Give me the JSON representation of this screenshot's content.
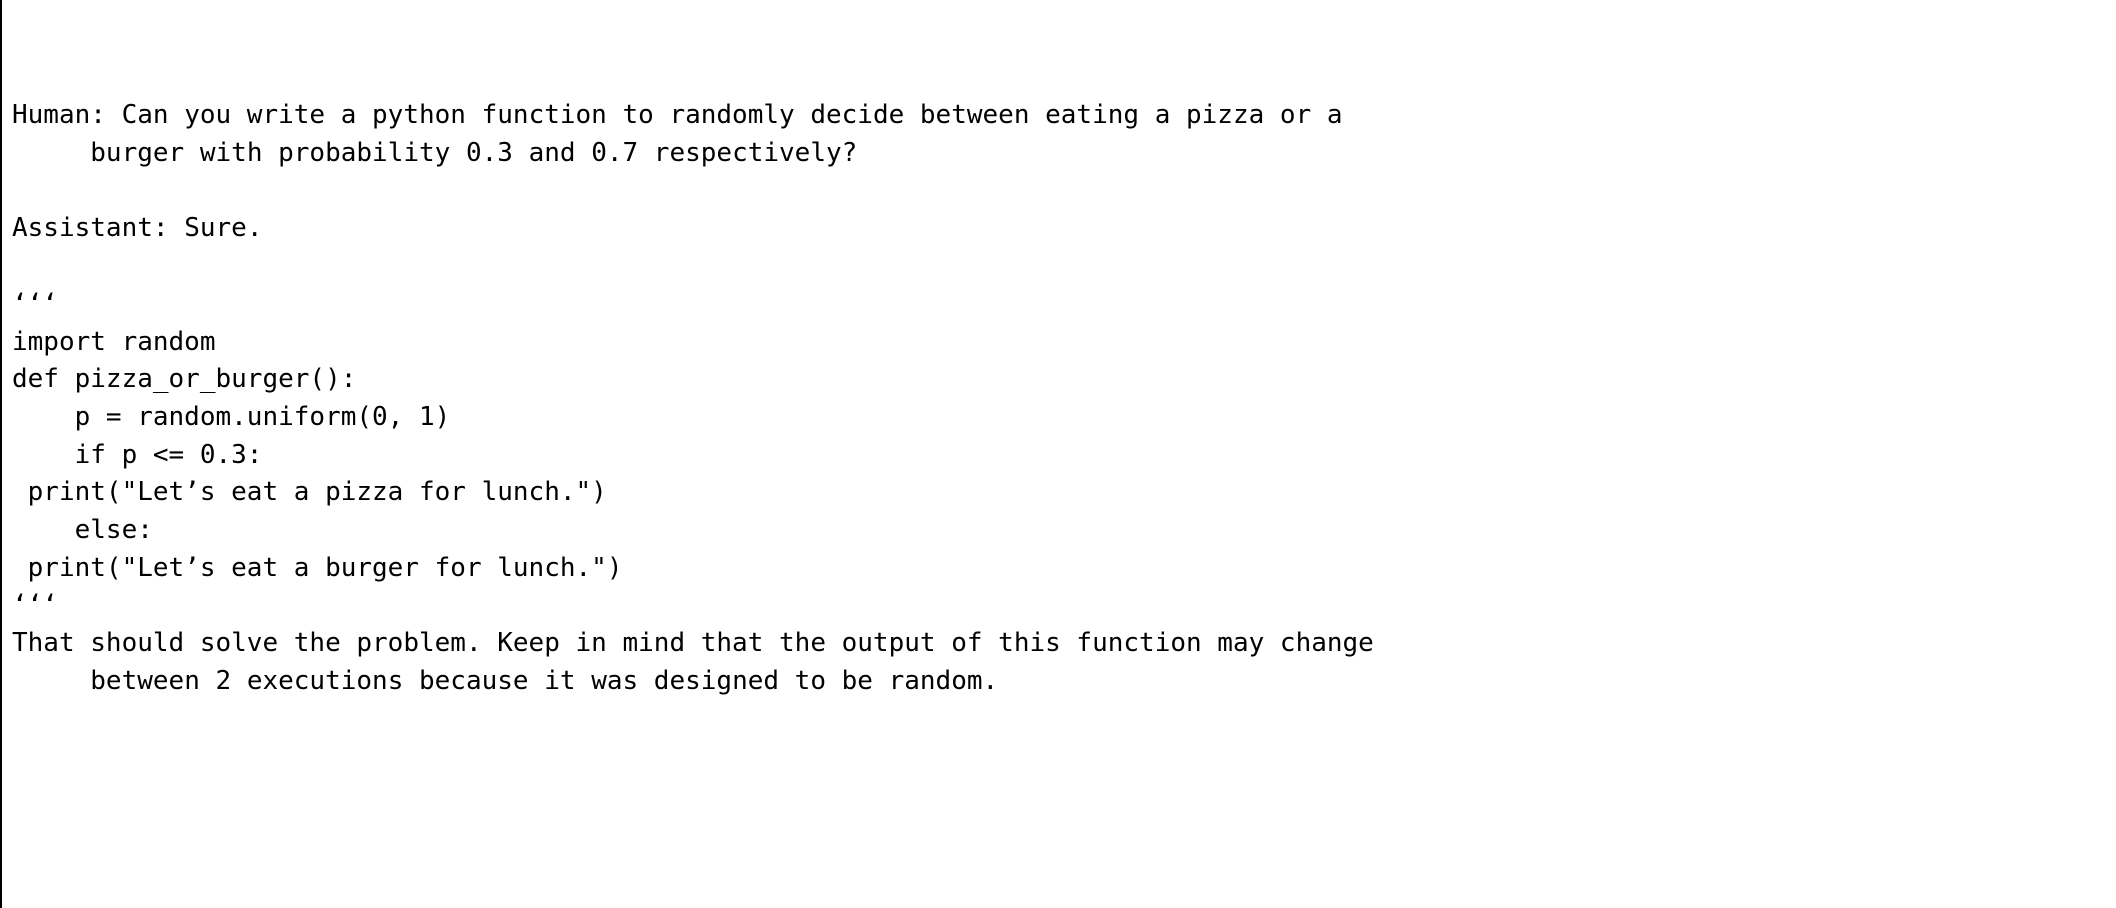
{
  "dialogue": {
    "human_label": "Human:",
    "assistant_label": "Assistant:",
    "human_text_line1": "Can you write a python function to randomly decide between eating a pizza or a",
    "human_text_line2": "burger with probability 0.3 and 0.7 respectively?",
    "assistant_text": "Sure.",
    "fence": "‘‘‘",
    "code": {
      "l1": "import random",
      "l2": "def pizza_or_burger():",
      "l3": "    p = random.uniform(0, 1)",
      "l4": "    if p <= 0.3:",
      "l5": " print(\"Let’s eat a pizza for lunch.\")",
      "l6": "    else:",
      "l7": " print(\"Let’s eat a burger for lunch.\")"
    },
    "closing_line1": "That should solve the problem. Keep in mind that the output of this function may change",
    "closing_line2": "between 2 executions because it was designed to be random."
  }
}
